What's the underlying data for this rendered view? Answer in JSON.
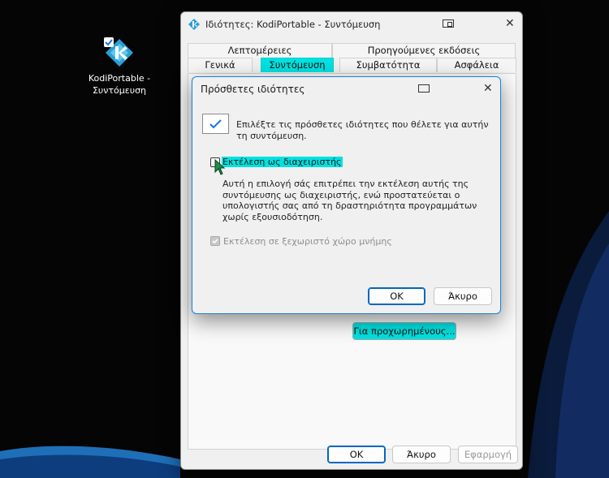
{
  "desktop": {
    "icon_label": "KodiPortable - Συντόμευση",
    "icon_name": "kodi-shortcut-icon"
  },
  "properties_window": {
    "title": "Ιδιότητες: KodiPortable - Συντόμευση",
    "tabs_row1": [
      "Λεπτομέρειες",
      "Προηγούμενες εκδόσεις"
    ],
    "tabs_row2": [
      "Γενικά",
      "Συντόμευση",
      "Συμβατότητα",
      "Ασφάλεια"
    ],
    "selected_tab": "Συντόμευση",
    "advanced_button": "Για προχωρημένους...",
    "buttons": {
      "ok": "OK",
      "cancel": "Άκυρο",
      "apply": "Εφαρμογή"
    }
  },
  "advanced_dialog": {
    "title": "Πρόσθετες ιδιότητες",
    "description": "Επιλέξτε τις πρόσθετες ιδιότητες που θέλετε για αυτήν τη συντόμευση.",
    "run_as_admin": {
      "label": "Εκτέλεση ως διαχειριστής",
      "checked": false,
      "help": "Αυτή η επιλογή σάς επιτρέπει την εκτέλεση αυτής της συντόμευσης ως διαχειριστής, ενώ προστατεύεται ο υπολογιστής σας από τη δραστηριότητα προγραμμάτων χωρίς εξουσιοδότηση."
    },
    "separate_memory": {
      "label": "Εκτέλεση σε ξεχωριστό χώρο μνήμης",
      "checked": true,
      "enabled": false
    },
    "buttons": {
      "ok": "OK",
      "cancel": "Άκυρο"
    }
  },
  "colors": {
    "highlight": "#00e1e1",
    "accent": "#0067c0",
    "dialog_border": "#1c7fd6",
    "wallpaper": "#050505"
  }
}
